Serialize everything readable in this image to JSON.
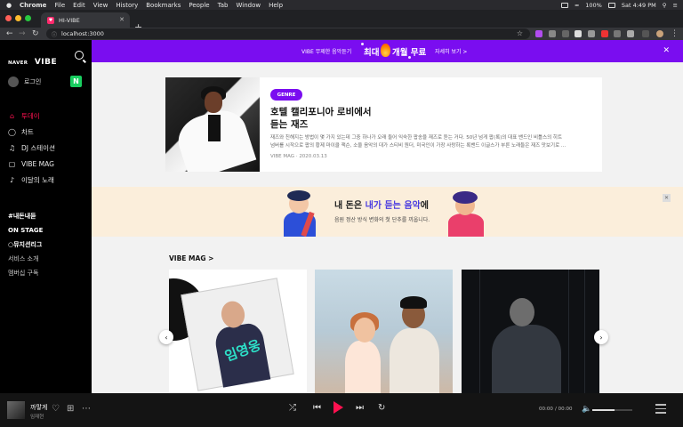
{
  "menubar": {
    "items": [
      "Chrome",
      "File",
      "Edit",
      "View",
      "History",
      "Bookmarks",
      "People",
      "Tab",
      "Window",
      "Help"
    ],
    "battery": "100%",
    "clock": "Sat 4:49 PM"
  },
  "browser": {
    "tab_title": "HI-VIBE",
    "url": "localhost:3000"
  },
  "sidebar": {
    "logo_naver": "NAVER",
    "logo_vibe": "VIBE",
    "login_label": "로그인",
    "naver_badge": "N",
    "nav": [
      {
        "label": "투데이",
        "icon": "home-icon"
      },
      {
        "label": "차트",
        "icon": "trophy-icon"
      },
      {
        "label": "DJ 스테이션",
        "icon": "headphones-icon"
      },
      {
        "label": "VIBE MAG",
        "icon": "magazine-icon"
      },
      {
        "label": "이달의 노래",
        "icon": "music-note-icon"
      }
    ],
    "extra": {
      "my_fund": "#내돈내듣",
      "onstage": "ON STAGE",
      "league": "뮤지션리그",
      "service": "서비스 소개",
      "membership": "멤버십 구독"
    }
  },
  "promo": {
    "text1": "VIBE 무제한 음악듣기",
    "text2": "최대",
    "text3": "개월 무료",
    "link": "자세히 보기 >",
    "color": "#7a0df0"
  },
  "feature": {
    "badge": "GENRE",
    "title_line1": "호텔 캘리포니아 로비에서",
    "title_line2": "듣는 재즈",
    "desc_line1": "재즈와 친해지는 방법이 몇 가지 있는데 그중 하나가 오래 들어 익숙한 팝송을 재즈로 듣는 거다. 50년 넘게 팝(록)의 대표 밴드인 비틀스의 히트",
    "desc_line2": "넘버를 시작으로 팝의 황제 마이클 잭슨, 소울 음악의 대가 스티비 원더, 미국인이 가장 사랑하는 록밴드 이글스가 부른 노래들은 재즈 맛보기로 ...",
    "source": "VIBE MAG",
    "date": "2020.03.13"
  },
  "banner": {
    "title_pre": "내 돈은 ",
    "title_hl": "내가 듣는 음악",
    "title_post": "에",
    "subtitle": "음원 정산 방식 변화의 첫 단추를 끼웁니다."
  },
  "mag_section": {
    "title": "VIBE MAG >",
    "card1_word": "임영웅"
  },
  "player": {
    "title": "까맣게",
    "artist": "임재현",
    "time_current": "00:00",
    "time_total": "/ 00:00",
    "volume": 0.55,
    "accent": "#ff1150"
  }
}
